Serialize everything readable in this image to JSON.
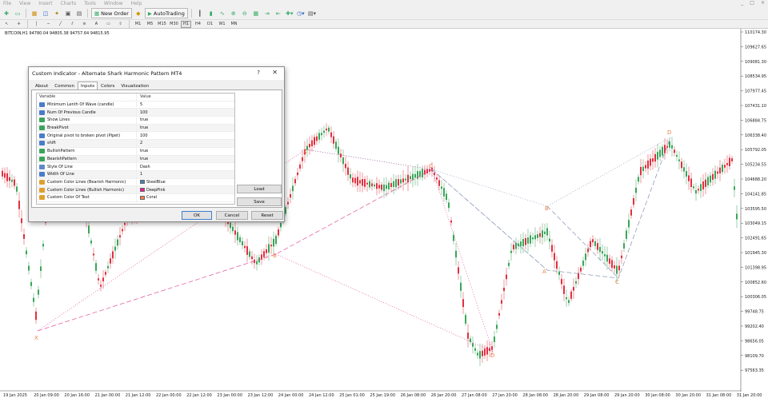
{
  "menu": {
    "items": [
      "File",
      "View",
      "Insert",
      "Charts",
      "Tools",
      "Window",
      "Help"
    ],
    "window_controls": [
      "_",
      "□",
      "×"
    ]
  },
  "toolbar": {
    "new_order": "New Order",
    "autotrading": "AutoTrading",
    "timeframes": [
      "M1",
      "M5",
      "M15",
      "M30",
      "H1",
      "H4",
      "D1",
      "W1",
      "MN"
    ]
  },
  "chart": {
    "symbol_label": "BITCOIN,H1  94780.04 94805.38 94757.64 94815.95",
    "price_ticks": [
      "110174.30",
      "109627.65",
      "109081.30",
      "108534.95",
      "107977.45",
      "107431.10",
      "106884.75",
      "106338.40",
      "105792.05",
      "105234.55",
      "104688.20",
      "104141.85",
      "103595.50",
      "103049.15",
      "102491.65",
      "101945.30",
      "101398.95",
      "100852.60",
      "100306.05",
      "99748.75",
      "99202.40",
      "98656.05",
      "98109.70",
      "97563.35"
    ],
    "time_ticks": [
      "19 Jan 2025",
      "20 Jan 09:00",
      "20 Jan 16:00",
      "21 Jan 00:00",
      "21 Jan 12:00",
      "22 Jan 00:00",
      "22 Jan 12:00",
      "23 Jan 00:00",
      "23 Jan 12:00",
      "24 Jan 00:00",
      "24 Jan 12:00",
      "25 Jan 01:00",
      "25 Jan 19:00",
      "26 Jan 08:00",
      "26 Jan 20:00",
      "27 Jan 08:00",
      "27 Jan 20:00",
      "28 Jan 08:00",
      "28 Jan 20:00",
      "29 Jan 08:00",
      "29 Jan 20:00",
      "30 Jan 08:00",
      "30 Jan 20:00",
      "31 Jan 08:00",
      "31 Jan 20:00"
    ],
    "pattern_labels": {
      "x1": "X",
      "b1": "B",
      "x2": "X",
      "c1": "C",
      "a1": "A",
      "b2": "B",
      "c2": "C",
      "d1": "D",
      "d2": "D",
      "a2": "A"
    },
    "colors": {
      "up": "#3aa55a",
      "down": "#e03040",
      "bullish_line": "#e0509a",
      "bearish_line": "#6688aa",
      "label": "#e9824a"
    }
  },
  "dialog": {
    "title": "Custom Indicator - Alternate Shark Harmonic Pattern MT4",
    "help": "?",
    "close": "✕",
    "tabs": [
      "About",
      "Common",
      "Inputs",
      "Colors",
      "Visualization"
    ],
    "active_tab": "Inputs",
    "table_headers": {
      "variable": "Variable",
      "value": "Value"
    },
    "params": [
      {
        "name": "Minimum Lenth Of Wave (candle)",
        "value": "5",
        "type": "int"
      },
      {
        "name": "Num Of Previous Candle",
        "value": "100",
        "type": "int"
      },
      {
        "name": "Show Lines",
        "value": "true",
        "type": "bool"
      },
      {
        "name": "BreakPivot",
        "value": "true",
        "type": "bool"
      },
      {
        "name": "Original pivot to broken pivot (Pipet)",
        "value": "100",
        "type": "int"
      },
      {
        "name": "shift",
        "value": "2",
        "type": "int"
      },
      {
        "name": "BullishPattern",
        "value": "true",
        "type": "bool"
      },
      {
        "name": "BearishPattern",
        "value": "true",
        "type": "bool"
      },
      {
        "name": "Style Of Line",
        "value": "Dash",
        "type": "enum"
      },
      {
        "name": "Width Of Line",
        "value": "1",
        "type": "int"
      },
      {
        "name": "Custom Color Lines (Bearish Harmonic)",
        "value": "SteelBlue",
        "type": "color",
        "swatch": "#4682b4"
      },
      {
        "name": "Custom Color Lines (Bullish Harmonic)",
        "value": "DeepPink",
        "type": "color",
        "swatch": "#ff1493"
      },
      {
        "name": "Custom Color Of Text",
        "value": "Coral",
        "type": "color",
        "swatch": "#ff7f50"
      }
    ],
    "buttons": {
      "load": "Load",
      "save": "Save",
      "ok": "OK",
      "cancel": "Cancel",
      "reset": "Reset"
    }
  }
}
